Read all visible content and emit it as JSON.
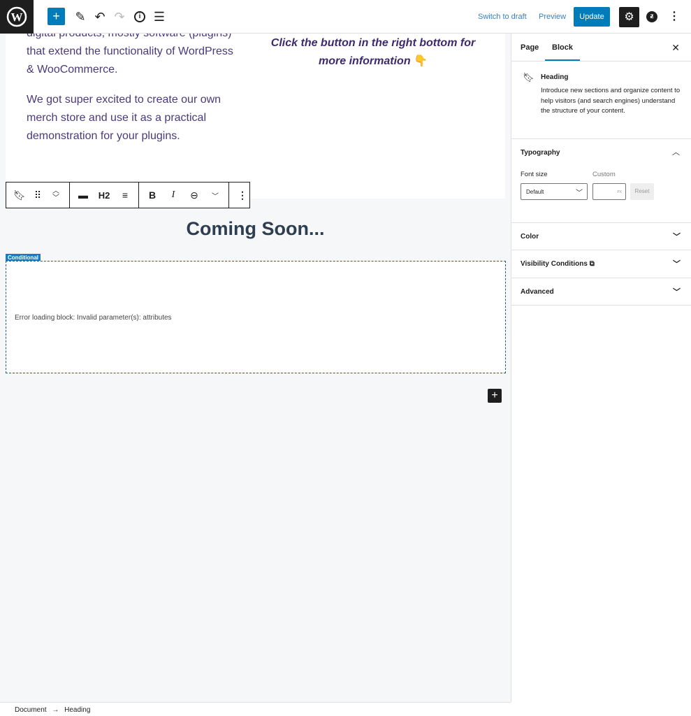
{
  "header": {
    "switch_draft": "Switch to draft",
    "preview": "Preview",
    "update": "Update",
    "accent": "#007cba"
  },
  "content": {
    "para1": [
      "digital products, mostly software (plugins)",
      "that extend the functionality of WordPress",
      "& WooCommerce."
    ],
    "para2": [
      "We got super excited to create our own",
      "merch store and use it as a practical",
      "demonstration for your plugins."
    ],
    "callout": [
      "Click the button in the right bottom for",
      "more information"
    ],
    "callout_emoji": "👇",
    "toolbar": {
      "level": "H2"
    },
    "heading": "Coming Soon...",
    "conditional_label": "Conditional",
    "error": "Error loading block: Invalid parameter(s): attributes"
  },
  "sidebar": {
    "tabs": [
      "Page",
      "Block"
    ],
    "block_name": "Heading",
    "block_desc": "Introduce new sections and organize content to help visitors (and search engines) understand the structure of your content.",
    "typography": "Typography",
    "font_size_label": "Font size",
    "custom_label": "Custom",
    "font_size_value": "Default",
    "unit": "PX",
    "reset": "Reset",
    "panels": [
      "Color",
      "Visibility Conditions",
      "Advanced"
    ]
  },
  "footer": {
    "crumbs": [
      "Document",
      "Heading"
    ],
    "sep": "→"
  }
}
